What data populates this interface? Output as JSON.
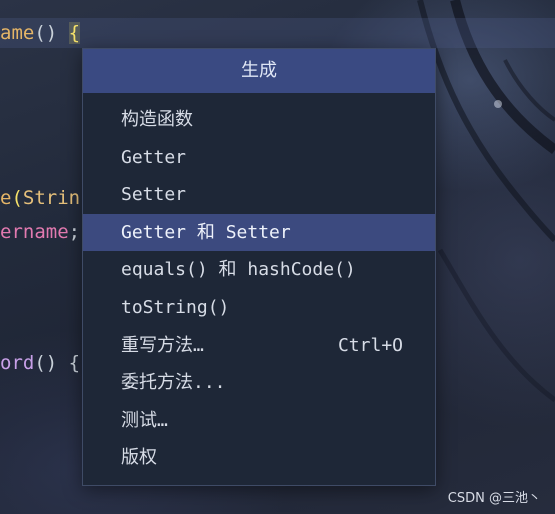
{
  "editor": {
    "lines": [
      {
        "fn": "ame",
        "parens": "()",
        "brace": "{"
      },
      {
        "fn": "e",
        "paren_open": "(",
        "type": "Strin"
      },
      {
        "var": "ername",
        "semicolon": ";"
      },
      {
        "fn": "ord",
        "parens": "()",
        "brace": "{"
      }
    ]
  },
  "menu": {
    "title": "生成",
    "items": [
      {
        "label": "构造函数",
        "shortcut": "",
        "selected": false
      },
      {
        "label": "Getter",
        "shortcut": "",
        "selected": false
      },
      {
        "label": "Setter",
        "shortcut": "",
        "selected": false
      },
      {
        "label": "Getter 和 Setter",
        "shortcut": "",
        "selected": true
      },
      {
        "label": "equals() 和 hashCode()",
        "shortcut": "",
        "selected": false
      },
      {
        "label": "toString()",
        "shortcut": "",
        "selected": false
      },
      {
        "label": "重写方法…",
        "shortcut": "Ctrl+O",
        "selected": false
      },
      {
        "label": "委托方法...",
        "shortcut": "",
        "selected": false
      },
      {
        "label": "测试…",
        "shortcut": "",
        "selected": false
      },
      {
        "label": "版权",
        "shortcut": "",
        "selected": false
      }
    ]
  },
  "watermark": "CSDN @三池丶"
}
